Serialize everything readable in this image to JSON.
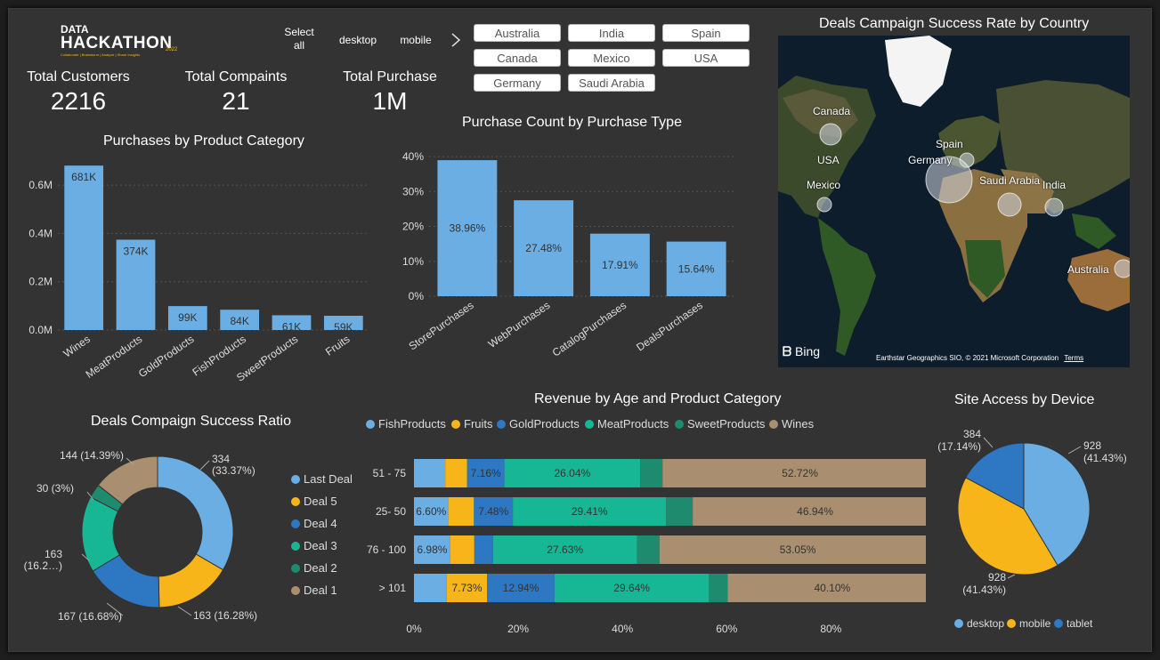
{
  "logo": {
    "line1": "DATA",
    "line2": "HACKATHON",
    "year": "2022",
    "tagline": "Collaborate | Brainstorm | Analyze | Share Insights"
  },
  "device_slicer": {
    "items": [
      "Select all",
      "desktop",
      "mobile"
    ],
    "next_icon": "chevron-right-icon"
  },
  "country_buttons": [
    "Australia",
    "India",
    "Spain",
    "Canada",
    "Mexico",
    "USA",
    "Germany",
    "Saudi Arabia"
  ],
  "kpis": [
    {
      "label": "Total Customers",
      "value": "2216"
    },
    {
      "label": "Total Compaints",
      "value": "21"
    },
    {
      "label": "Total Purchase",
      "value": "1M"
    }
  ],
  "colors": {
    "blue": "#6aaee3",
    "yellow": "#f7b519",
    "darkblue": "#2e77c2",
    "teal": "#17b694",
    "darkteal": "#1e8a6e",
    "tan": "#a98f70",
    "background": "#333333"
  },
  "map": {
    "title": "Deals Campaign Success Rate by Country",
    "labels": [
      "Canada",
      "Spain",
      "USA",
      "Germany",
      "Mexico",
      "Saudi Arabia",
      "India",
      "Australia"
    ],
    "bing": "Bing",
    "copyright": "Earthstar Geographics SIO, © 2021 Microsoft Corporation",
    "terms": "Terms"
  },
  "chart_data": [
    {
      "id": "product",
      "type": "bar",
      "title": "Purchases by Product Category",
      "categories": [
        "Wines",
        "MeatProducts",
        "GoldProducts",
        "FishProducts",
        "SweetProducts",
        "Fruits"
      ],
      "values": [
        681000,
        374000,
        99000,
        84000,
        61000,
        59000
      ],
      "data_labels": [
        "681K",
        "374K",
        "99K",
        "84K",
        "61K",
        "59K"
      ],
      "ytick_labels": [
        "0.0M",
        "0.2M",
        "0.4M",
        "0.6M"
      ],
      "yticks": [
        0,
        200000,
        400000,
        600000
      ],
      "ylim": [
        0,
        700000
      ]
    },
    {
      "id": "purchase_type",
      "type": "bar",
      "title": "Purchase Count by Purchase Type",
      "categories": [
        "StorePurchases",
        "WebPurchases",
        "CatalogPurchases",
        "DealsPurchases"
      ],
      "values": [
        38.96,
        27.48,
        17.91,
        15.64
      ],
      "data_labels": [
        "38.96%",
        "27.48%",
        "17.91%",
        "15.64%"
      ],
      "ytick_labels": [
        "0%",
        "10%",
        "20%",
        "30%",
        "40%"
      ],
      "yticks": [
        0,
        10,
        20,
        30,
        40
      ],
      "ylim": [
        0,
        40
      ]
    },
    {
      "id": "deals",
      "type": "pie",
      "title": "Deals Compaign Success Ratio",
      "categories": [
        "Last Deal",
        "Deal 5",
        "Deal 4",
        "Deal 3",
        "Deal 2",
        "Deal 1"
      ],
      "values": [
        334,
        163,
        167,
        163,
        30,
        144
      ],
      "data_labels": [
        "334\n(33.37%)",
        "163 (16.28%)",
        "167 (16.68%)",
        "163\n(16.2…)",
        "30 (3%)",
        "144 (14.39%)"
      ],
      "colors": [
        "#6aaee3",
        "#f7b519",
        "#2e77c2",
        "#17b694",
        "#1e8a6e",
        "#a98f70"
      ]
    },
    {
      "id": "revenue_age",
      "type": "bar",
      "title": "Revenue by Age and Product Category",
      "categories": [
        "51 - 75",
        "25- 50",
        "76 - 100",
        "> 101"
      ],
      "series": [
        {
          "name": "FishProducts",
          "values": [
            6.0,
            6.6,
            6.98,
            6.3
          ]
        },
        {
          "name": "Fruits",
          "values": [
            4.2,
            4.9,
            4.6,
            7.73
          ]
        },
        {
          "name": "GoldProducts",
          "values": [
            7.16,
            7.48,
            3.6,
            12.94
          ]
        },
        {
          "name": "MeatProducts",
          "values": [
            26.04,
            29.41,
            27.63,
            29.64
          ]
        },
        {
          "name": "SweetProducts",
          "values": [
            4.3,
            5.1,
            4.3,
            3.6
          ]
        },
        {
          "name": "Wines",
          "values": [
            52.72,
            46.94,
            53.05,
            40.1
          ]
        }
      ],
      "data_labels": [
        [
          "",
          "",
          "7.16%",
          "26.04%",
          "",
          "52.72%"
        ],
        [
          "6.60%",
          "",
          "7.48%",
          "29.41%",
          "",
          "46.94%"
        ],
        [
          "6.98%",
          "",
          "",
          "27.63%",
          "",
          "53.05%"
        ],
        [
          "",
          "7.73%",
          "12.94%",
          "29.64%",
          "",
          "40.10%"
        ]
      ],
      "colors": [
        "#6aaee3",
        "#f7b519",
        "#2e77c2",
        "#17b694",
        "#1e8a6e",
        "#a98f70"
      ],
      "xtick_labels": [
        "0%",
        "20%",
        "40%",
        "60%",
        "80%"
      ],
      "xticks": [
        0,
        20,
        40,
        60,
        80
      ],
      "xlim": [
        0,
        96
      ]
    },
    {
      "id": "device",
      "type": "pie",
      "title": "Site Access by Device",
      "categories": [
        "desktop",
        "mobile",
        "tablet"
      ],
      "values": [
        928,
        928,
        384
      ],
      "data_labels": [
        "928\n(41.43%)",
        "928\n(41.43%)",
        "384\n(17.14%)"
      ],
      "colors": [
        "#6aaee3",
        "#f7b519",
        "#2e77c2"
      ]
    }
  ]
}
